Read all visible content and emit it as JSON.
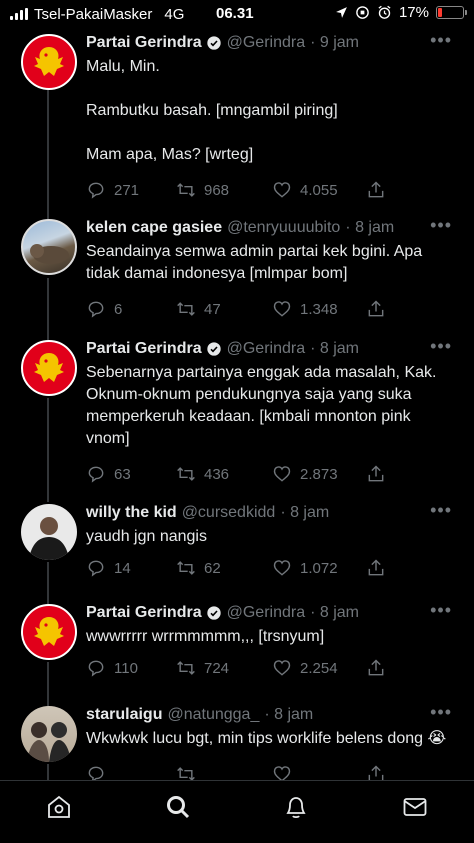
{
  "status": {
    "carrier": "Tsel-PakaiMasker",
    "network": "4G",
    "time": "06.31",
    "battery": "17%",
    "battery_level": 0.17
  },
  "tweets": [
    {
      "name": "Partai Gerindra",
      "handle": "@Gerindra",
      "time": "· 9 jam",
      "verified": true,
      "text": "Malu, Min.\n\nRambutku basah. [mngambil piring]\n\nMam apa, Mas? [wrteg]",
      "replies": "271",
      "retweets": "968",
      "likes": "4.055"
    },
    {
      "name": "kelen cape gasiee",
      "handle": "@tenryuuuubito",
      "time": "· 8 jam",
      "verified": false,
      "text": "Seandainya semwa admin partai kek bgini. Apa tidak damai indonesya [mlmpar bom]",
      "replies": "6",
      "retweets": "47",
      "likes": "1.348"
    },
    {
      "name": "Partai Gerindra",
      "handle": "@Gerindra",
      "time": "· 8 jam",
      "verified": true,
      "text": "Sebenarnya partainya enggak ada masalah, Kak. Oknum-oknum pendukungnya saja yang suka memperkeruh keadaan. [kmbali mnonton pink vnom]",
      "replies": "63",
      "retweets": "436",
      "likes": "2.873"
    },
    {
      "name": "willy the kid",
      "handle": "@cursedkidd",
      "time": "· 8 jam",
      "verified": false,
      "text": "yaudh jgn nangis",
      "replies": "14",
      "retweets": "62",
      "likes": "1.072"
    },
    {
      "name": "Partai Gerindra",
      "handle": "@Gerindra",
      "time": "· 8 jam",
      "verified": true,
      "text": "wwwrrrrr wrrmmmmm,,, [trsnyum]",
      "replies": "110",
      "retweets": "724",
      "likes": "2.254"
    },
    {
      "name": "starulaigu",
      "handle": "@natungga_",
      "time": "· 8 jam",
      "verified": false,
      "text": "Wkwkwk lucu bgt, min tips worklife belens dong 😭",
      "replies": "",
      "retweets": "",
      "likes": ""
    }
  ],
  "tabs": [
    "home-icon",
    "search-icon",
    "notifications-icon",
    "messages-icon"
  ],
  "colors": {
    "background": "#000000",
    "text": "#e7e9ea",
    "secondary": "#71767b",
    "verified": "#1d9bf0",
    "gerindra_red": "#e1001a",
    "gerindra_gold": "#f5c400"
  }
}
